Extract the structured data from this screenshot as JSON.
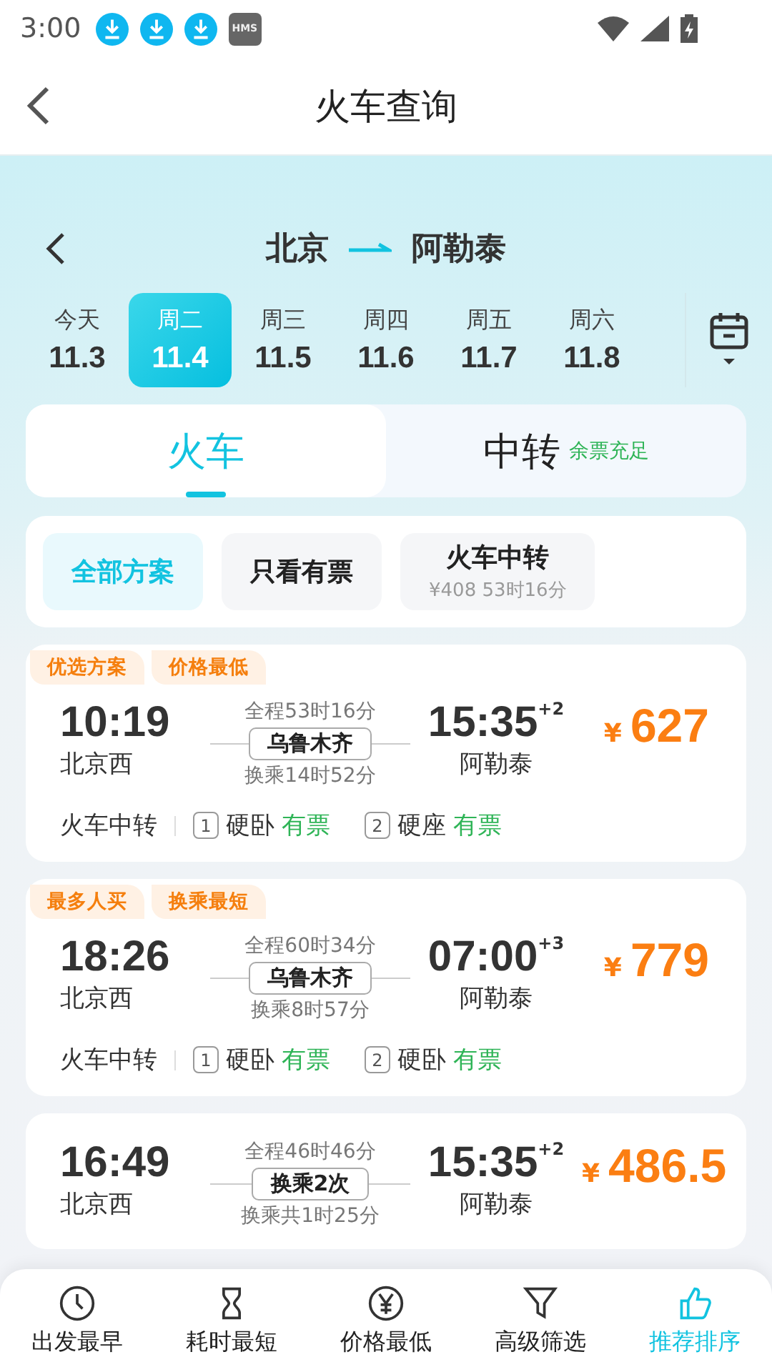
{
  "status_bar": {
    "time": "3:00",
    "badge": "HMS"
  },
  "header": {
    "title": "火车查询"
  },
  "route": {
    "from": "北京",
    "to": "阿勒泰"
  },
  "dates": [
    {
      "weekday": "今天",
      "date": "11.3",
      "selected": false
    },
    {
      "weekday": "周二",
      "date": "11.4",
      "selected": true
    },
    {
      "weekday": "周三",
      "date": "11.5",
      "selected": false
    },
    {
      "weekday": "周四",
      "date": "11.6",
      "selected": false
    },
    {
      "weekday": "周五",
      "date": "11.7",
      "selected": false
    },
    {
      "weekday": "周六",
      "date": "11.8",
      "selected": false
    }
  ],
  "mode_tabs": [
    {
      "label": "火车",
      "selected": true
    },
    {
      "label": "中转",
      "note": "余票充足",
      "selected": false
    }
  ],
  "filters": [
    {
      "label": "全部方案",
      "selected": true
    },
    {
      "label": "只看有票",
      "selected": false
    },
    {
      "label": "火车中转",
      "sub": "¥408 53时16分",
      "selected": false
    }
  ],
  "results": [
    {
      "tags": [
        "优选方案",
        "价格最低"
      ],
      "depart_time": "10:19",
      "depart_station": "北京西",
      "total": "全程53时16分",
      "via": "乌鲁木齐",
      "wait": "换乘14时52分",
      "arrive_time": "15:35",
      "day_offset": "+2",
      "arrive_station": "阿勒泰",
      "currency": "¥",
      "price": "627",
      "legs_label": "火车中转",
      "legs": [
        {
          "index": "1",
          "seat": "硬卧",
          "availability": "有票"
        },
        {
          "index": "2",
          "seat": "硬座",
          "availability": "有票"
        }
      ]
    },
    {
      "tags": [
        "最多人买",
        "换乘最短"
      ],
      "depart_time": "18:26",
      "depart_station": "北京西",
      "total": "全程60时34分",
      "via": "乌鲁木齐",
      "wait": "换乘8时57分",
      "arrive_time": "07:00",
      "day_offset": "+3",
      "arrive_station": "阿勒泰",
      "currency": "¥",
      "price": "779",
      "legs_label": "火车中转",
      "legs": [
        {
          "index": "1",
          "seat": "硬卧",
          "availability": "有票"
        },
        {
          "index": "2",
          "seat": "硬卧",
          "availability": "有票"
        }
      ]
    },
    {
      "depart_time": "16:49",
      "depart_station": "北京西",
      "total": "全程46时46分",
      "via": "换乘2次",
      "wait": "换乘共1时25分",
      "arrive_time": "15:35",
      "day_offset": "+2",
      "arrive_station": "阿勒泰",
      "currency": "¥",
      "price": "486.5"
    }
  ],
  "bottom_bar": [
    {
      "kind": "clock",
      "label": "出发最早",
      "selected": false
    },
    {
      "kind": "hourglass",
      "label": "耗时最短",
      "selected": false
    },
    {
      "kind": "yen",
      "label": "价格最低",
      "selected": false
    },
    {
      "kind": "filter",
      "label": "高级筛选",
      "selected": false
    },
    {
      "kind": "thumb",
      "label": "推荐排序",
      "selected": true
    }
  ]
}
